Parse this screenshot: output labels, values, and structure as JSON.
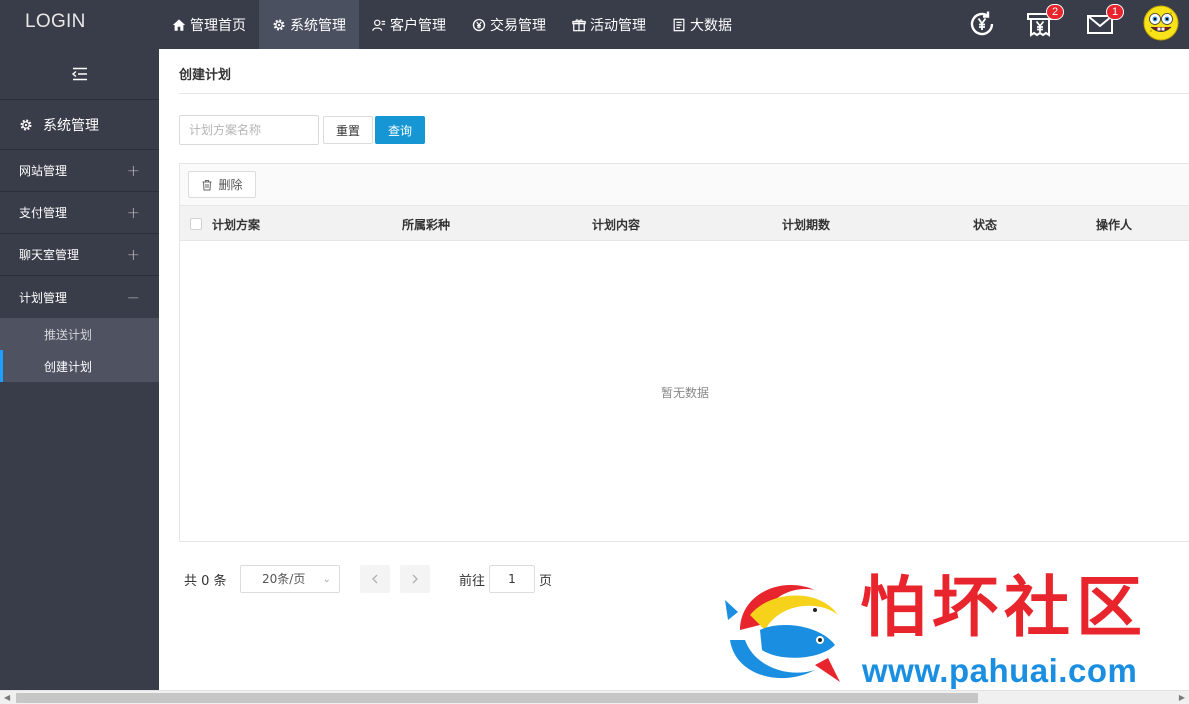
{
  "header": {
    "logo": "LOGIN",
    "nav": [
      {
        "label": "管理首页",
        "icon": "home-icon"
      },
      {
        "label": "系统管理",
        "icon": "gear-icon",
        "active": true
      },
      {
        "label": "客户管理",
        "icon": "users-icon"
      },
      {
        "label": "交易管理",
        "icon": "yen-circle-icon"
      },
      {
        "label": "活动管理",
        "icon": "gift-icon"
      },
      {
        "label": "大数据",
        "icon": "document-icon"
      }
    ],
    "notifications": {
      "receipt_badge": "2",
      "mail_badge": "1"
    }
  },
  "sidebar": {
    "section_title": "系统管理",
    "items": [
      {
        "label": "网站管理",
        "sign": "+"
      },
      {
        "label": "支付管理",
        "sign": "+"
      },
      {
        "label": "聊天室管理",
        "sign": "+"
      },
      {
        "label": "计划管理",
        "sign": "−"
      }
    ],
    "sub_items": [
      {
        "label": "推送计划"
      },
      {
        "label": "创建计划",
        "active": true
      }
    ]
  },
  "main": {
    "title": "创建计划",
    "search": {
      "placeholder": "计划方案名称",
      "reset_label": "重置",
      "query_label": "查询"
    },
    "toolbar": {
      "delete_label": "删除"
    },
    "table": {
      "columns": [
        "计划方案",
        "所属彩种",
        "计划内容",
        "计划期数",
        "状态",
        "操作人"
      ],
      "empty_text": "暂无数据"
    },
    "pagination": {
      "total": "共 0 条",
      "page_size": "20条/页",
      "goto_label": "前往",
      "page_value": "1",
      "page_suffix": "页"
    }
  },
  "watermark": {
    "title": "怕坏社区",
    "url": "www.pahuai.com"
  },
  "colors": {
    "topbar": "#393d49",
    "accent": "#1697d4",
    "badge": "#e8242c",
    "watermark_red": "#e8242c",
    "watermark_blue": "#1a8ee0"
  }
}
